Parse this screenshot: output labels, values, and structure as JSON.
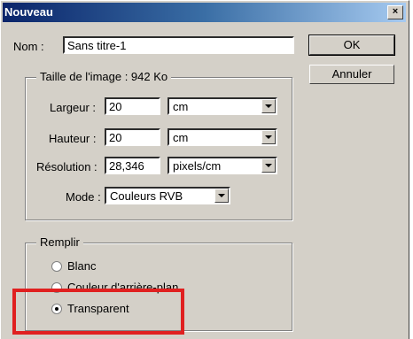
{
  "dialog": {
    "title": "Nouveau",
    "close_label": "×",
    "name_label": "Nom :",
    "name_value": "Sans titre-1",
    "ok_label": "OK",
    "cancel_label": "Annuler"
  },
  "image_size": {
    "legend": "Taille de l'image : 942 Ko",
    "width_label": "Largeur :",
    "width_value": "20",
    "width_unit": "cm",
    "height_label": "Hauteur :",
    "height_value": "20",
    "height_unit": "cm",
    "resolution_label": "Résolution :",
    "resolution_value": "28,346",
    "resolution_unit": "pixels/cm",
    "mode_label": "Mode :",
    "mode_value": "Couleurs RVB"
  },
  "fill": {
    "legend": "Remplir",
    "options": [
      {
        "label": "Blanc",
        "checked": false
      },
      {
        "label": "Couleur d'arrière-plan",
        "checked": false
      },
      {
        "label": "Transparent",
        "checked": true
      }
    ]
  },
  "colors": {
    "highlight": "#e02020",
    "titlebar": "#0a246a"
  }
}
